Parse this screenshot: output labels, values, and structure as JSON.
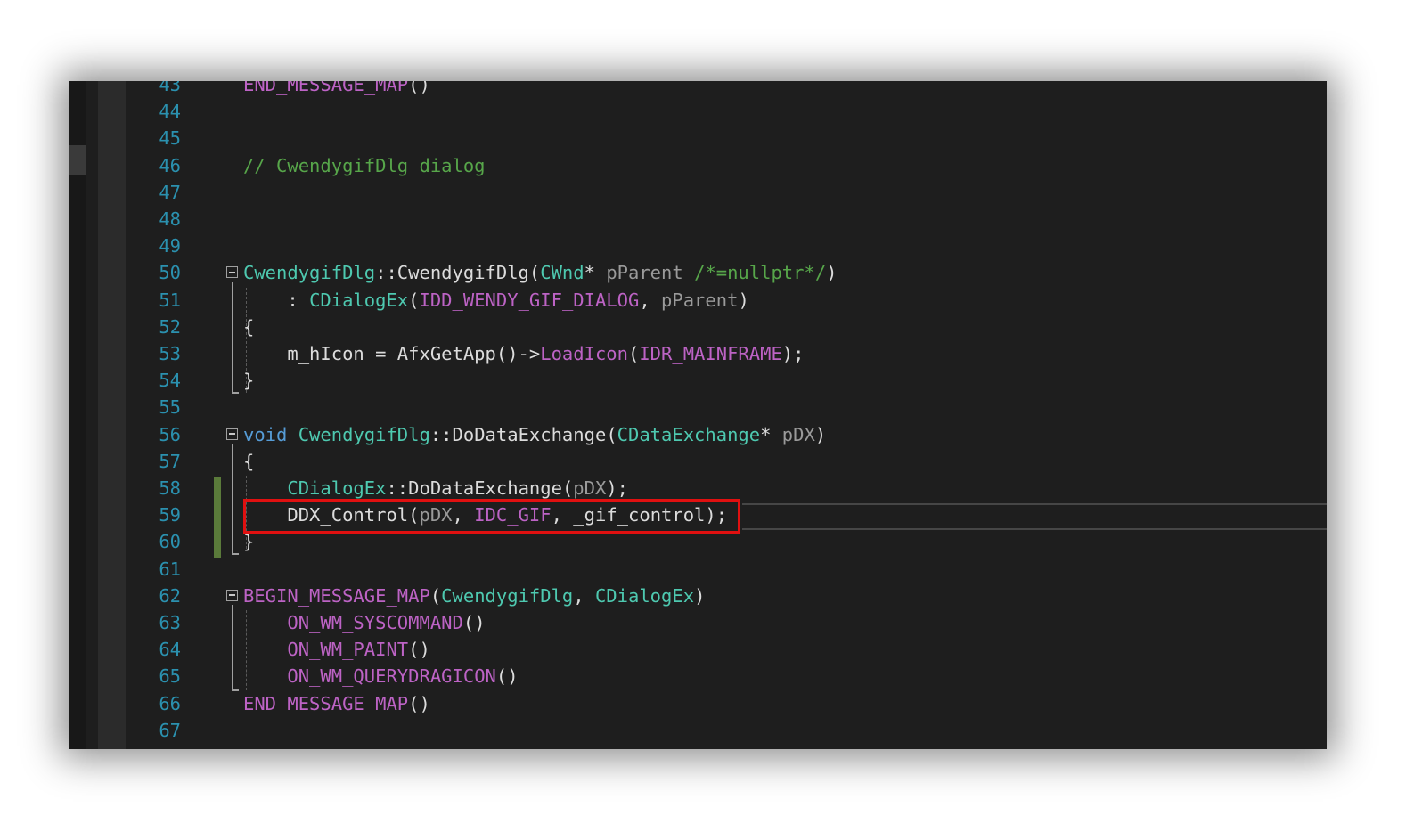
{
  "editor": {
    "lines": [
      {
        "num": "43",
        "tokens": [
          [
            "END_MESSAGE_MAP",
            "macro"
          ],
          [
            "()",
            "plain"
          ]
        ]
      },
      {
        "num": "44",
        "tokens": []
      },
      {
        "num": "45",
        "tokens": []
      },
      {
        "num": "46",
        "tokens": [
          [
            "// CwendygifDlg dialog",
            "comment"
          ]
        ]
      },
      {
        "num": "47",
        "tokens": []
      },
      {
        "num": "48",
        "tokens": []
      },
      {
        "num": "49",
        "tokens": []
      },
      {
        "num": "50",
        "tokens": [
          [
            "CwendygifDlg",
            "type"
          ],
          [
            "::",
            "plain"
          ],
          [
            "CwendygifDlg",
            "plain"
          ],
          [
            "(",
            "plain"
          ],
          [
            "CWnd",
            "type"
          ],
          [
            "* ",
            "plain"
          ],
          [
            "pParent",
            "param"
          ],
          [
            " ",
            "plain"
          ],
          [
            "/*=nullptr*/",
            "comment"
          ],
          [
            ")",
            "plain"
          ]
        ]
      },
      {
        "num": "51",
        "tokens": [
          [
            "    : ",
            "plain"
          ],
          [
            "CDialogEx",
            "type"
          ],
          [
            "(",
            "plain"
          ],
          [
            "IDD_WENDY_GIF_DIALOG",
            "macro"
          ],
          [
            ", ",
            "plain"
          ],
          [
            "pParent",
            "param"
          ],
          [
            ")",
            "plain"
          ]
        ]
      },
      {
        "num": "52",
        "tokens": [
          [
            "{",
            "plain"
          ]
        ]
      },
      {
        "num": "53",
        "tokens": [
          [
            "    m_hIcon = AfxGetApp()->",
            "plain"
          ],
          [
            "LoadIcon",
            "macro"
          ],
          [
            "(",
            "plain"
          ],
          [
            "IDR_MAINFRAME",
            "macro"
          ],
          [
            ");",
            "plain"
          ]
        ]
      },
      {
        "num": "54",
        "tokens": [
          [
            "}",
            "plain"
          ]
        ]
      },
      {
        "num": "55",
        "tokens": []
      },
      {
        "num": "56",
        "tokens": [
          [
            "void",
            "kw"
          ],
          [
            " ",
            "plain"
          ],
          [
            "CwendygifDlg",
            "type"
          ],
          [
            "::",
            "plain"
          ],
          [
            "DoDataExchange",
            "plain"
          ],
          [
            "(",
            "plain"
          ],
          [
            "CDataExchange",
            "type"
          ],
          [
            "* ",
            "plain"
          ],
          [
            "pDX",
            "param"
          ],
          [
            ")",
            "plain"
          ]
        ]
      },
      {
        "num": "57",
        "tokens": [
          [
            "{",
            "plain"
          ]
        ]
      },
      {
        "num": "58",
        "tokens": [
          [
            "    ",
            "plain"
          ],
          [
            "CDialogEx",
            "type"
          ],
          [
            "::",
            "plain"
          ],
          [
            "DoDataExchange",
            "plain"
          ],
          [
            "(",
            "plain"
          ],
          [
            "pDX",
            "param"
          ],
          [
            ");",
            "plain"
          ]
        ]
      },
      {
        "num": "59",
        "tokens": [
          [
            "    DDX_Control(",
            "plain"
          ],
          [
            "pDX",
            "param"
          ],
          [
            ", ",
            "plain"
          ],
          [
            "IDC_GIF",
            "macro"
          ],
          [
            ", _gif_control);",
            "plain"
          ]
        ]
      },
      {
        "num": "60",
        "tokens": [
          [
            "}",
            "plain"
          ]
        ]
      },
      {
        "num": "61",
        "tokens": []
      },
      {
        "num": "62",
        "tokens": [
          [
            "BEGIN_MESSAGE_MAP",
            "macro"
          ],
          [
            "(",
            "plain"
          ],
          [
            "CwendygifDlg",
            "type"
          ],
          [
            ", ",
            "plain"
          ],
          [
            "CDialogEx",
            "type"
          ],
          [
            ")",
            "plain"
          ]
        ]
      },
      {
        "num": "63",
        "tokens": [
          [
            "    ",
            "plain"
          ],
          [
            "ON_WM_SYSCOMMAND",
            "macro"
          ],
          [
            "()",
            "plain"
          ]
        ]
      },
      {
        "num": "64",
        "tokens": [
          [
            "    ",
            "plain"
          ],
          [
            "ON_WM_PAINT",
            "macro"
          ],
          [
            "()",
            "plain"
          ]
        ]
      },
      {
        "num": "65",
        "tokens": [
          [
            "    ",
            "plain"
          ],
          [
            "ON_WM_QUERYDRAGICON",
            "macro"
          ],
          [
            "()",
            "plain"
          ]
        ]
      },
      {
        "num": "66",
        "tokens": [
          [
            "END_MESSAGE_MAP",
            "macro"
          ],
          [
            "()",
            "plain"
          ]
        ]
      },
      {
        "num": "67",
        "tokens": []
      }
    ],
    "fold_icons": [
      "50",
      "56",
      "62"
    ],
    "highlighted_line": "59",
    "colors": {
      "background": "#1e1e1e",
      "line_number": "#2b91af",
      "comment": "#57a64a",
      "macro": "#bd63c5",
      "type": "#4ec9b0",
      "keyword": "#569cd6",
      "parameter": "#9a9a9a",
      "highlight_box": "#e01010",
      "change_bar": "#5a7a3a"
    }
  }
}
